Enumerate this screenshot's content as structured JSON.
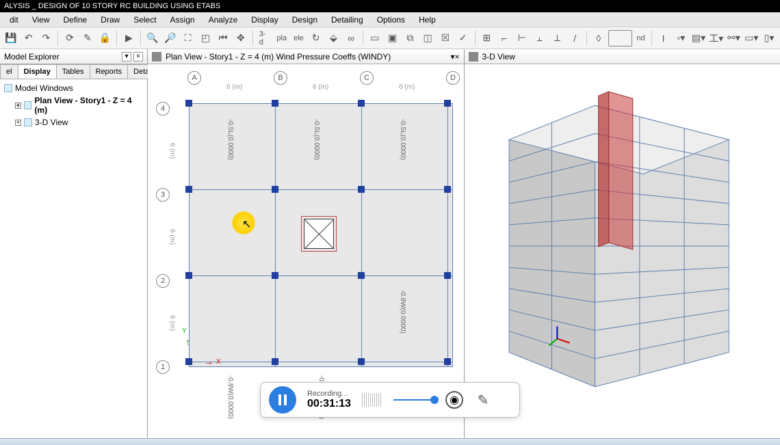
{
  "title": "ALYSIS _ DESIGN OF 10 STORY RC BUILDING USING ETABS",
  "menu": {
    "items": [
      "dit",
      "View",
      "Define",
      "Draw",
      "Select",
      "Assign",
      "Analyze",
      "Display",
      "Design",
      "Detailing",
      "Options",
      "Help"
    ]
  },
  "toolbar": {
    "label3d": "3-d",
    "labelPla": "pla",
    "labelEle": "ele",
    "labelNd": "nd"
  },
  "explorer": {
    "title": "Model Explorer",
    "tabs": [
      "el",
      "Display",
      "Tables",
      "Reports",
      "Detailing"
    ],
    "active_tab": 1,
    "root": "Model Windows",
    "items": [
      "Plan View - Story1 - Z = 4 (m)",
      "3-D View"
    ]
  },
  "plan_view": {
    "title": "Plan View - Story1 - Z = 4 (m)  Wind Pressure Coeffs (WINDY)",
    "col_letters": [
      "A",
      "B",
      "C",
      "D"
    ],
    "row_numbers": [
      "4",
      "3",
      "2",
      "1"
    ],
    "span": "6 (m)",
    "load_top": "-0.5L(0.0000)",
    "load_bottom": "-0.8W(0.0000)",
    "axis_x": "X",
    "axis_y": "Y"
  },
  "view3d": {
    "title": "3-D View"
  },
  "recorder": {
    "status": "Recording...",
    "time": "00:31:13"
  }
}
